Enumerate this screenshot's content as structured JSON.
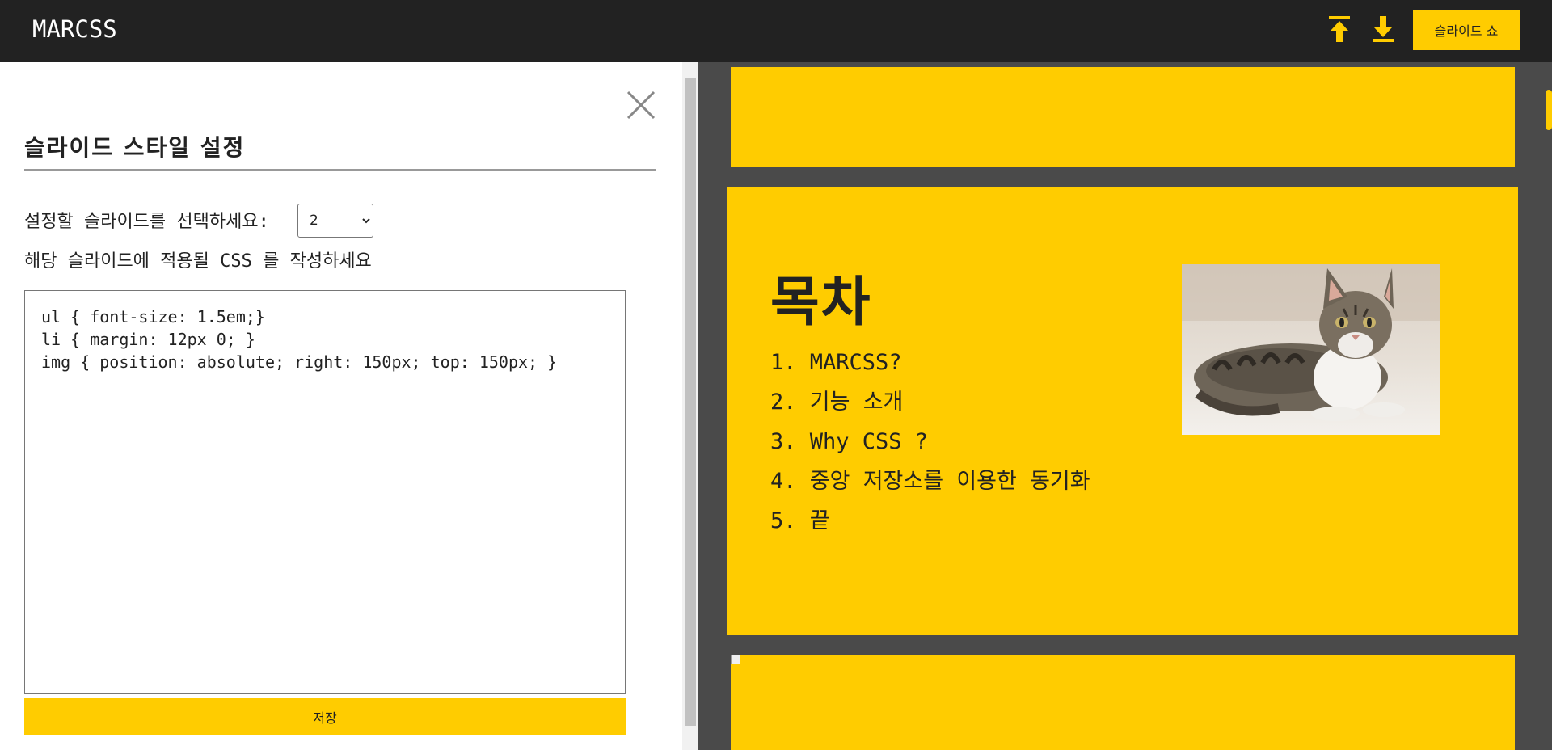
{
  "header": {
    "logo": "MARCSS",
    "upload_icon": "upload-arrow-icon",
    "download_icon": "download-arrow-icon",
    "slideshow_label": "슬라이드 쇼",
    "accent_color": "#ffcc00",
    "background_color": "#222222"
  },
  "panel": {
    "close_icon": "close-icon",
    "title": "슬라이드 스타일 설정",
    "select_label": "설정할 슬라이드를 선택하세요:",
    "selected_slide": "2",
    "css_label": "해당 슬라이드에 적용될 CSS 를 작성하세요",
    "css_code": "ul { font-size: 1.5em;}\nli { margin: 12px 0; }\nimg { position: absolute; right: 150px; top: 150px; }",
    "save_label": "저장"
  },
  "preview": {
    "slide_color": "#ffcc00",
    "background_color": "#4a4a4a",
    "slide2": {
      "heading": "목차",
      "items": [
        "1. MARCSS?",
        "2. 기능 소개",
        "3. Why CSS ?",
        "4. 중앙 저장소를 이용한 동기화",
        "5. 끝"
      ],
      "image": "tabby-cat-photo"
    }
  }
}
